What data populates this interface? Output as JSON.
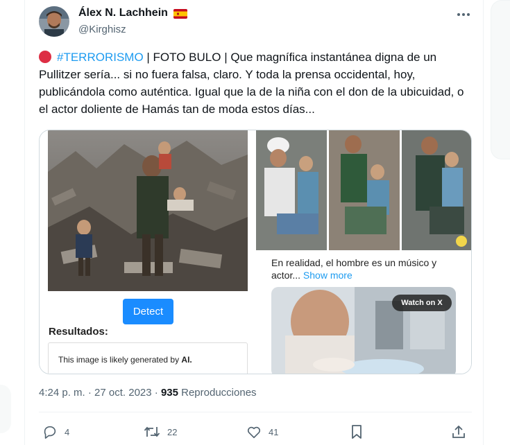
{
  "tweet": {
    "author_name": "Álex N. Lachhein",
    "handle": "@Kirghisz",
    "text_hashtag": "#TERRORISMO",
    "text_body": " | FOTO BULO | Que magnífica instantánea digna de un Pullitzer sería... si no fuera falsa, claro. Y toda la prensa occidental, hoy, publicándola como auténtica. Igual que la de la niña con el don de la ubicuidad, o el actor doliente  de Hamás tan de moda estos días...",
    "timestamp": "4:24 p. m. · 27 oct. 2023 · ",
    "views_count": "935",
    "views_label": " Reproducciones"
  },
  "media": {
    "left": {
      "detect_button": "Detect",
      "results_label": "Resultados:",
      "result_prefix": "This image is likely generated by ",
      "result_ai": "AI."
    },
    "right": {
      "caption": "En realidad, el hombre es un músico y actor...",
      "show_more": " Show more",
      "watch_badge": "Watch on X"
    }
  },
  "actions": {
    "replies": "4",
    "reposts": "22",
    "likes": "41"
  },
  "icons": [
    "more-icon",
    "reply-icon",
    "repost-icon",
    "like-icon",
    "bookmark-icon",
    "share-icon",
    "spain-flag-icon",
    "red-circle-icon"
  ],
  "colors": {
    "accent": "#1d9bf0",
    "detect_button": "#1a8cff",
    "text_secondary": "#536471",
    "red_dot": "#dd2e44"
  }
}
